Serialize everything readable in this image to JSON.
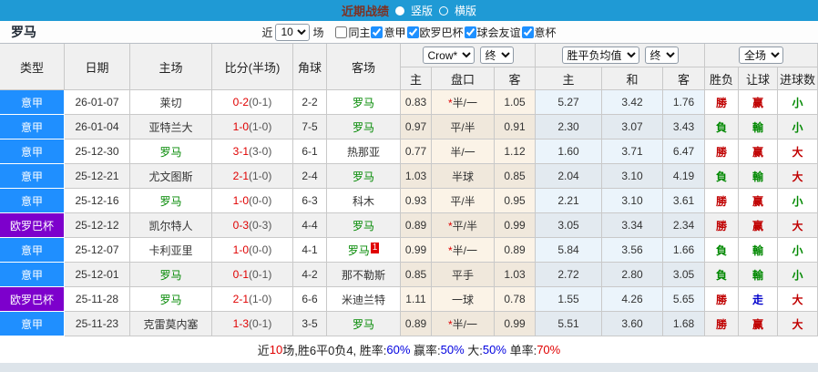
{
  "topbar": {
    "title": "近期战绩",
    "layout_options": [
      {
        "label": "竖版",
        "selected": true
      },
      {
        "label": "横版",
        "selected": false
      }
    ]
  },
  "filterbar": {
    "team": "罗马",
    "near_label": "近",
    "count_value": "10",
    "games_label": "场",
    "checkboxes": [
      {
        "label": "同主",
        "checked": false
      },
      {
        "label": "意甲",
        "checked": true
      },
      {
        "label": "欧罗巴杯",
        "checked": true
      },
      {
        "label": "球会友谊",
        "checked": true
      },
      {
        "label": "意杯",
        "checked": true
      }
    ]
  },
  "table": {
    "columns": {
      "league": "类型",
      "date": "日期",
      "home": "主场",
      "score": "比分(半场)",
      "corners": "角球",
      "away": "客场"
    },
    "dropdowns": {
      "odds_source": "Crow*",
      "odds_final_1": "终",
      "wdl_source": "胜平负均值",
      "odds_final_2": "终",
      "scope": "全场"
    },
    "subheaders": {
      "h1": "主",
      "h2": "盘口",
      "h3": "客",
      "h4": "主",
      "h5": "和",
      "h6": "客",
      "h7": "胜负",
      "h8": "让球",
      "h9": "进球数"
    },
    "rows": [
      {
        "league": "意甲",
        "league_color": "blue",
        "date": "26-01-07",
        "home": "莱切",
        "home_green": false,
        "score": "0-2",
        "half": "(0-1)",
        "corners": "2-2",
        "away": "罗马",
        "away_green": true,
        "away_badge": "",
        "odds_home": "0.83",
        "handicap_star": true,
        "handicap": "半/一",
        "odds_away": "1.05",
        "avg_home": "5.27",
        "avg_draw": "3.42",
        "avg_away": "1.76",
        "res_wl": "勝",
        "res_wl_color": "red",
        "res_handicap": "赢",
        "res_handicap_color": "red",
        "res_goals": "小",
        "res_goals_color": "green"
      },
      {
        "league": "意甲",
        "league_color": "blue",
        "date": "26-01-04",
        "home": "亚特兰大",
        "home_green": false,
        "score": "1-0",
        "half": "(1-0)",
        "corners": "7-5",
        "away": "罗马",
        "away_green": true,
        "away_badge": "",
        "odds_home": "0.97",
        "handicap_star": false,
        "handicap": "平/半",
        "odds_away": "0.91",
        "avg_home": "2.30",
        "avg_draw": "3.07",
        "avg_away": "3.43",
        "res_wl": "負",
        "res_wl_color": "green",
        "res_handicap": "輸",
        "res_handicap_color": "green",
        "res_goals": "小",
        "res_goals_color": "green"
      },
      {
        "league": "意甲",
        "league_color": "blue",
        "date": "25-12-30",
        "home": "罗马",
        "home_green": true,
        "score": "3-1",
        "half": "(3-0)",
        "corners": "6-1",
        "away": "热那亚",
        "away_green": false,
        "away_badge": "",
        "odds_home": "0.77",
        "handicap_star": false,
        "handicap": "半/一",
        "odds_away": "1.12",
        "avg_home": "1.60",
        "avg_draw": "3.71",
        "avg_away": "6.47",
        "res_wl": "勝",
        "res_wl_color": "red",
        "res_handicap": "赢",
        "res_handicap_color": "red",
        "res_goals": "大",
        "res_goals_color": "red"
      },
      {
        "league": "意甲",
        "league_color": "blue",
        "date": "25-12-21",
        "home": "尤文图斯",
        "home_green": false,
        "score": "2-1",
        "half": "(1-0)",
        "corners": "2-4",
        "away": "罗马",
        "away_green": true,
        "away_badge": "",
        "odds_home": "1.03",
        "handicap_star": false,
        "handicap": "半球",
        "odds_away": "0.85",
        "avg_home": "2.04",
        "avg_draw": "3.10",
        "avg_away": "4.19",
        "res_wl": "負",
        "res_wl_color": "green",
        "res_handicap": "輸",
        "res_handicap_color": "green",
        "res_goals": "大",
        "res_goals_color": "red"
      },
      {
        "league": "意甲",
        "league_color": "blue",
        "date": "25-12-16",
        "home": "罗马",
        "home_green": true,
        "score": "1-0",
        "half": "(0-0)",
        "corners": "6-3",
        "away": "科木",
        "away_green": false,
        "away_badge": "",
        "odds_home": "0.93",
        "handicap_star": false,
        "handicap": "平/半",
        "odds_away": "0.95",
        "avg_home": "2.21",
        "avg_draw": "3.10",
        "avg_away": "3.61",
        "res_wl": "勝",
        "res_wl_color": "red",
        "res_handicap": "赢",
        "res_handicap_color": "red",
        "res_goals": "小",
        "res_goals_color": "green"
      },
      {
        "league": "欧罗巴杯",
        "league_color": "purple",
        "date": "25-12-12",
        "home": "凯尔特人",
        "home_green": false,
        "score": "0-3",
        "half": "(0-3)",
        "corners": "4-4",
        "away": "罗马",
        "away_green": true,
        "away_badge": "",
        "odds_home": "0.89",
        "handicap_star": true,
        "handicap": "平/半",
        "odds_away": "0.99",
        "avg_home": "3.05",
        "avg_draw": "3.34",
        "avg_away": "2.34",
        "res_wl": "勝",
        "res_wl_color": "red",
        "res_handicap": "赢",
        "res_handicap_color": "red",
        "res_goals": "大",
        "res_goals_color": "red"
      },
      {
        "league": "意甲",
        "league_color": "blue",
        "date": "25-12-07",
        "home": "卡利亚里",
        "home_green": false,
        "score": "1-0",
        "half": "(0-0)",
        "corners": "4-1",
        "away": "罗马",
        "away_green": true,
        "away_badge": "1",
        "odds_home": "0.99",
        "handicap_star": true,
        "handicap": "半/一",
        "odds_away": "0.89",
        "avg_home": "5.84",
        "avg_draw": "3.56",
        "avg_away": "1.66",
        "res_wl": "負",
        "res_wl_color": "green",
        "res_handicap": "輸",
        "res_handicap_color": "green",
        "res_goals": "小",
        "res_goals_color": "green"
      },
      {
        "league": "意甲",
        "league_color": "blue",
        "date": "25-12-01",
        "home": "罗马",
        "home_green": true,
        "score": "0-1",
        "half": "(0-1)",
        "corners": "4-2",
        "away": "那不勒斯",
        "away_green": false,
        "away_badge": "",
        "odds_home": "0.85",
        "handicap_star": false,
        "handicap": "平手",
        "odds_away": "1.03",
        "avg_home": "2.72",
        "avg_draw": "2.80",
        "avg_away": "3.05",
        "res_wl": "負",
        "res_wl_color": "green",
        "res_handicap": "輸",
        "res_handicap_color": "green",
        "res_goals": "小",
        "res_goals_color": "green"
      },
      {
        "league": "欧罗巴杯",
        "league_color": "purple",
        "date": "25-11-28",
        "home": "罗马",
        "home_green": true,
        "score": "2-1",
        "half": "(1-0)",
        "corners": "6-6",
        "away": "米迪兰特",
        "away_green": false,
        "away_badge": "",
        "odds_home": "1.11",
        "handicap_star": false,
        "handicap": "一球",
        "odds_away": "0.78",
        "avg_home": "1.55",
        "avg_draw": "4.26",
        "avg_away": "5.65",
        "res_wl": "勝",
        "res_wl_color": "red",
        "res_handicap": "走",
        "res_handicap_color": "blue",
        "res_goals": "大",
        "res_goals_color": "red"
      },
      {
        "league": "意甲",
        "league_color": "blue",
        "date": "25-11-23",
        "home": "克雷莫内塞",
        "home_green": false,
        "score": "1-3",
        "half": "(0-1)",
        "corners": "3-5",
        "away": "罗马",
        "away_green": true,
        "away_badge": "",
        "odds_home": "0.89",
        "handicap_star": true,
        "handicap": "半/一",
        "odds_away": "0.99",
        "avg_home": "5.51",
        "avg_draw": "3.60",
        "avg_away": "1.68",
        "res_wl": "勝",
        "res_wl_color": "red",
        "res_handicap": "赢",
        "res_handicap_color": "red",
        "res_goals": "大",
        "res_goals_color": "red"
      }
    ]
  },
  "summary": {
    "segments": [
      {
        "text": "近",
        "color": "black"
      },
      {
        "text": "10",
        "color": "red"
      },
      {
        "text": "场,胜6平0负4, 胜率:",
        "color": "black"
      },
      {
        "text": "60%",
        "color": "blue"
      },
      {
        "text": " 赢率:",
        "color": "black"
      },
      {
        "text": "50%",
        "color": "blue"
      },
      {
        "text": " 大:",
        "color": "black"
      },
      {
        "text": "50%",
        "color": "blue"
      },
      {
        "text": " 单率:",
        "color": "black"
      },
      {
        "text": "70%",
        "color": "red"
      }
    ]
  },
  "colors": {
    "topbar_bg": "#1f9ad5",
    "topbar_title_text": "#7e3122",
    "serie_a_cell": "#1f8fff",
    "europa_cell": "#7d00cc",
    "team_highlight_green": "#008800",
    "score_red": "#e00000",
    "result_red": "#c00000",
    "result_green": "#008800",
    "result_blue": "#0000cc"
  }
}
